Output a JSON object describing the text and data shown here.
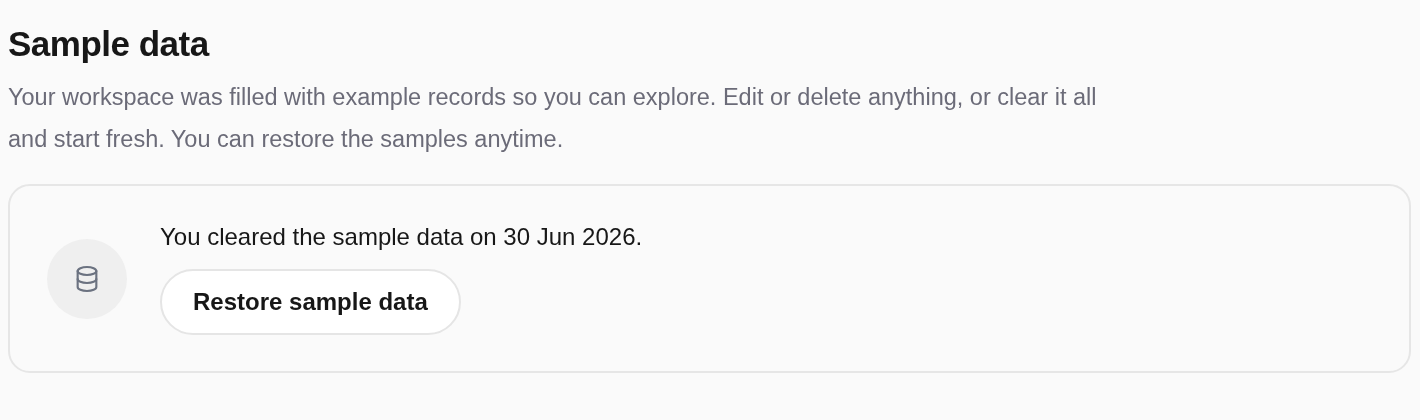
{
  "section": {
    "title": "Sample data",
    "description": "Your workspace was filled with example records so you can explore. Edit or delete anything, or clear it all and start fresh. You can restore the samples anytime."
  },
  "notice": {
    "message": "You cleared the sample data on 30 Jun 2026.",
    "button": "Restore sample data"
  }
}
